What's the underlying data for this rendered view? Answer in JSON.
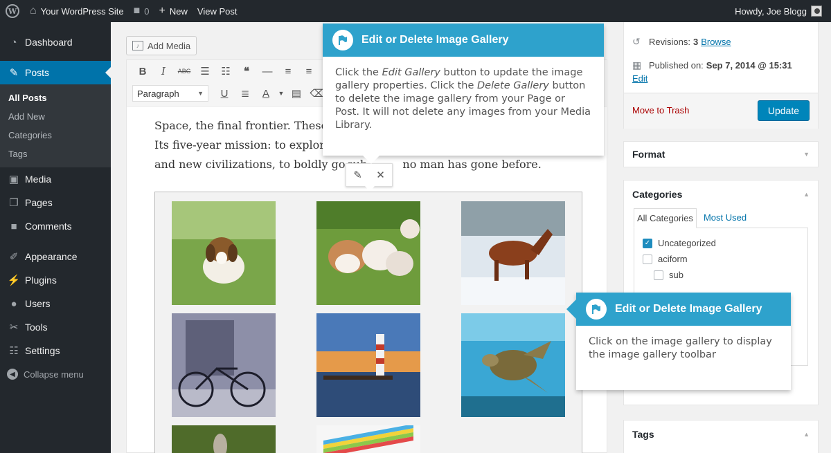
{
  "adminbar": {
    "site_name": "Your WordPress Site",
    "comments_count": "0",
    "new_label": "New",
    "view_post": "View Post",
    "howdy": "Howdy, Joe Blogg"
  },
  "sidebar": {
    "items": [
      {
        "label": "Dashboard",
        "icon": "dashboard-icon"
      },
      {
        "label": "Posts",
        "icon": "pin-icon"
      },
      {
        "label": "Media",
        "icon": "media-icon"
      },
      {
        "label": "Pages",
        "icon": "pages-icon"
      },
      {
        "label": "Comments",
        "icon": "comments-icon"
      },
      {
        "label": "Appearance",
        "icon": "brush-icon"
      },
      {
        "label": "Plugins",
        "icon": "plug-icon"
      },
      {
        "label": "Users",
        "icon": "user-icon"
      },
      {
        "label": "Tools",
        "icon": "wrench-icon"
      },
      {
        "label": "Settings",
        "icon": "settings-icon"
      }
    ],
    "posts_sub": [
      "All Posts",
      "Add New",
      "Categories",
      "Tags"
    ],
    "collapse": "Collapse menu"
  },
  "editor": {
    "add_media": "Add Media",
    "format_select": "Paragraph",
    "paragraph_lines": [
      "Space, the final frontier. These",
      "Its five-year mission: to explor",
      "and new civilizations, to boldly go"
    ],
    "paragraph_tail": "no man has gone before.",
    "paragraph_frag": "sub"
  },
  "publish": {
    "revisions_label": "Revisions:",
    "revisions_count": "3",
    "revisions_link": "Browse",
    "published_label": "Published on:",
    "published_date": "Sep 7, 2014 @ 15:31",
    "edit_link": "Edit",
    "trash": "Move to Trash",
    "update": "Update"
  },
  "format_box": {
    "title": "Format"
  },
  "categories_box": {
    "title": "Categories",
    "tab_all": "All Categories",
    "tab_used": "Most Used",
    "items": [
      {
        "label": "Uncategorized",
        "checked": true
      },
      {
        "label": "aciform",
        "checked": false
      },
      {
        "label": "sub",
        "checked": false
      }
    ]
  },
  "tags_box": {
    "title": "Tags"
  },
  "pointer_top": {
    "title": "Edit or Delete Image Gallery",
    "body_1": "Click the ",
    "body_em1": "Edit Gallery",
    "body_2": " button to update the image gallery properties. Click the ",
    "body_em2": "Delete Gallery",
    "body_3": " button to delete the image gallery from your Page or Post. It will not delete any images from your Media Library."
  },
  "pointer_side": {
    "title": "Edit or Delete Image Gallery",
    "body": "Click on the image gallery to display the image gallery toolbar"
  },
  "colors": {
    "admin_dark": "#23282d",
    "accent_blue": "#0073aa",
    "pointer_blue": "#2ea2cc",
    "update_blue": "#0085ba"
  }
}
